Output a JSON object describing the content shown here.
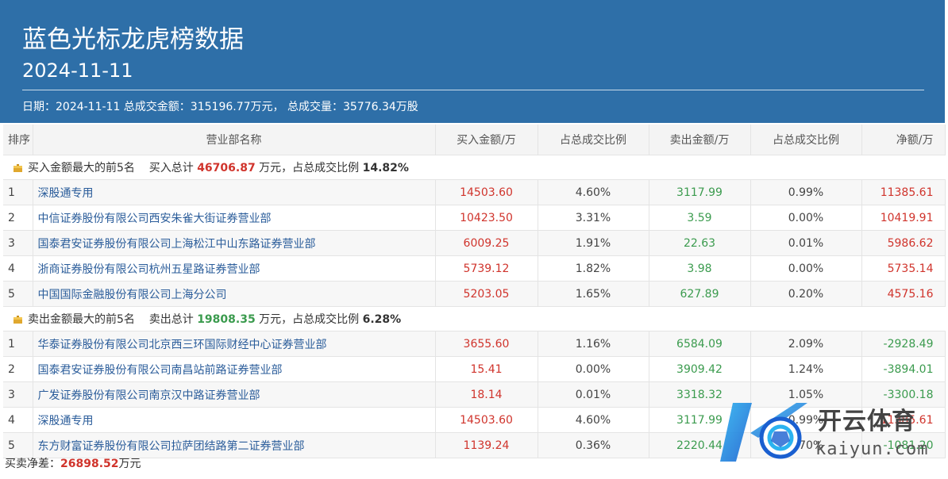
{
  "header": {
    "title": "蓝色光标龙虎榜数据",
    "date": "2024-11-11",
    "summary": "日期：2024-11-11 总成交金额：315196.77万元， 总成交量：35776.34万股"
  },
  "columns": [
    "排序",
    "营业部名称",
    "买入金额/万",
    "占总成交比例",
    "卖出金额/万",
    "占总成交比例",
    "净额/万"
  ],
  "buy_section": {
    "label": "买入金额最大的前5名",
    "total_label": "买入总计",
    "total_value": "46706.87",
    "total_unit": "万元，占总成交比例",
    "ratio": "14.82%",
    "rows": [
      {
        "rank": "1",
        "name": "深股通专用",
        "buy": "14503.60",
        "buy_ratio": "4.60%",
        "sell": "3117.99",
        "sell_ratio": "0.99%",
        "net": "11385.61"
      },
      {
        "rank": "2",
        "name": "中信证券股份有限公司西安朱雀大街证券营业部",
        "buy": "10423.50",
        "buy_ratio": "3.31%",
        "sell": "3.59",
        "sell_ratio": "0.00%",
        "net": "10419.91"
      },
      {
        "rank": "3",
        "name": "国泰君安证券股份有限公司上海松江中山东路证券营业部",
        "buy": "6009.25",
        "buy_ratio": "1.91%",
        "sell": "22.63",
        "sell_ratio": "0.01%",
        "net": "5986.62"
      },
      {
        "rank": "4",
        "name": "浙商证券股份有限公司杭州五星路证券营业部",
        "buy": "5739.12",
        "buy_ratio": "1.82%",
        "sell": "3.98",
        "sell_ratio": "0.00%",
        "net": "5735.14"
      },
      {
        "rank": "5",
        "name": "中国国际金融股份有限公司上海分公司",
        "buy": "5203.05",
        "buy_ratio": "1.65%",
        "sell": "627.89",
        "sell_ratio": "0.20%",
        "net": "4575.16"
      }
    ]
  },
  "sell_section": {
    "label": "卖出金额最大的前5名",
    "total_label": "卖出总计",
    "total_value": "19808.35",
    "total_unit": "万元，占总成交比例",
    "ratio": "6.28%",
    "rows": [
      {
        "rank": "1",
        "name": "华泰证券股份有限公司北京西三环国际财经中心证券营业部",
        "buy": "3655.60",
        "buy_ratio": "1.16%",
        "sell": "6584.09",
        "sell_ratio": "2.09%",
        "net": "-2928.49"
      },
      {
        "rank": "2",
        "name": "国泰君安证券股份有限公司南昌站前路证券营业部",
        "buy": "15.41",
        "buy_ratio": "0.00%",
        "sell": "3909.42",
        "sell_ratio": "1.24%",
        "net": "-3894.01"
      },
      {
        "rank": "3",
        "name": "广发证券股份有限公司南京汉中路证券营业部",
        "buy": "18.14",
        "buy_ratio": "0.01%",
        "sell": "3318.32",
        "sell_ratio": "1.05%",
        "net": "-3300.18"
      },
      {
        "rank": "4",
        "name": "深股通专用",
        "buy": "14503.60",
        "buy_ratio": "4.60%",
        "sell": "3117.99",
        "sell_ratio": "0.99%",
        "net": "11385.61"
      },
      {
        "rank": "5",
        "name": "东方财富证券股份有限公司拉萨团结路第二证券营业部",
        "buy": "1139.24",
        "buy_ratio": "0.36%",
        "sell": "2220.44",
        "sell_ratio": "0.70%",
        "net": "-1081.20"
      }
    ]
  },
  "footer": {
    "label": "买卖净差：",
    "value": "26898.52",
    "unit": "万元"
  },
  "watermark": {
    "text": "开云体育",
    "sub": "kaiyun.com"
  },
  "colors": {
    "header_bg": "#2e6fa8",
    "buy": "#d0342c",
    "sell": "#3b9b4e",
    "link": "#2a5c9a"
  }
}
